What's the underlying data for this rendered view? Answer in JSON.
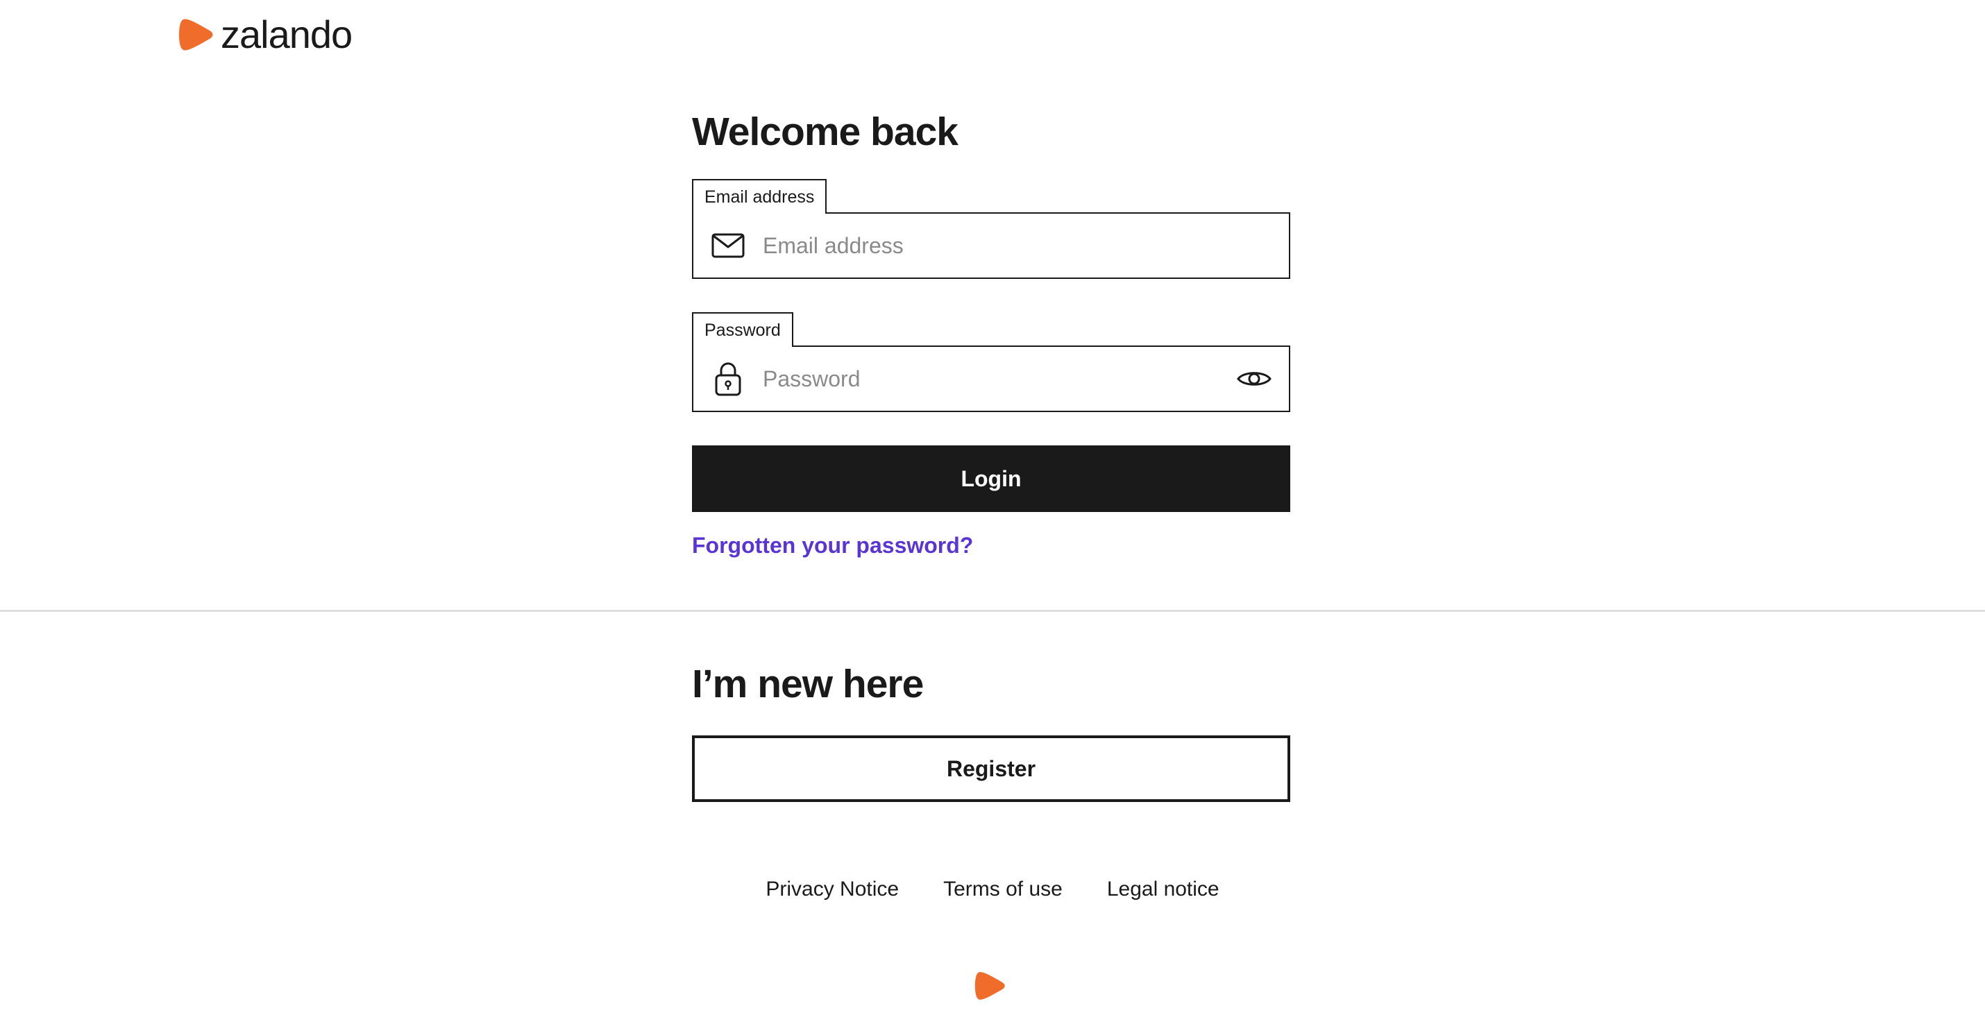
{
  "header": {
    "brand_name": "zalando",
    "brand_color": "#ef6c2b"
  },
  "login": {
    "heading": "Welcome back",
    "email": {
      "label": "Email address",
      "placeholder": "Email address",
      "value": "",
      "icon": "envelope-icon"
    },
    "password": {
      "label": "Password",
      "placeholder": "Password",
      "value": "",
      "icon": "lock-icon",
      "toggle_icon": "eye-icon"
    },
    "submit_label": "Login",
    "forgot_label": "Forgotten your password?",
    "link_color": "#5a35d6"
  },
  "register": {
    "heading": "I’m new here",
    "button_label": "Register"
  },
  "footer": {
    "links": [
      "Privacy Notice",
      "Terms of use",
      "Legal notice"
    ],
    "logo_icon": "zalando-mark-icon"
  }
}
